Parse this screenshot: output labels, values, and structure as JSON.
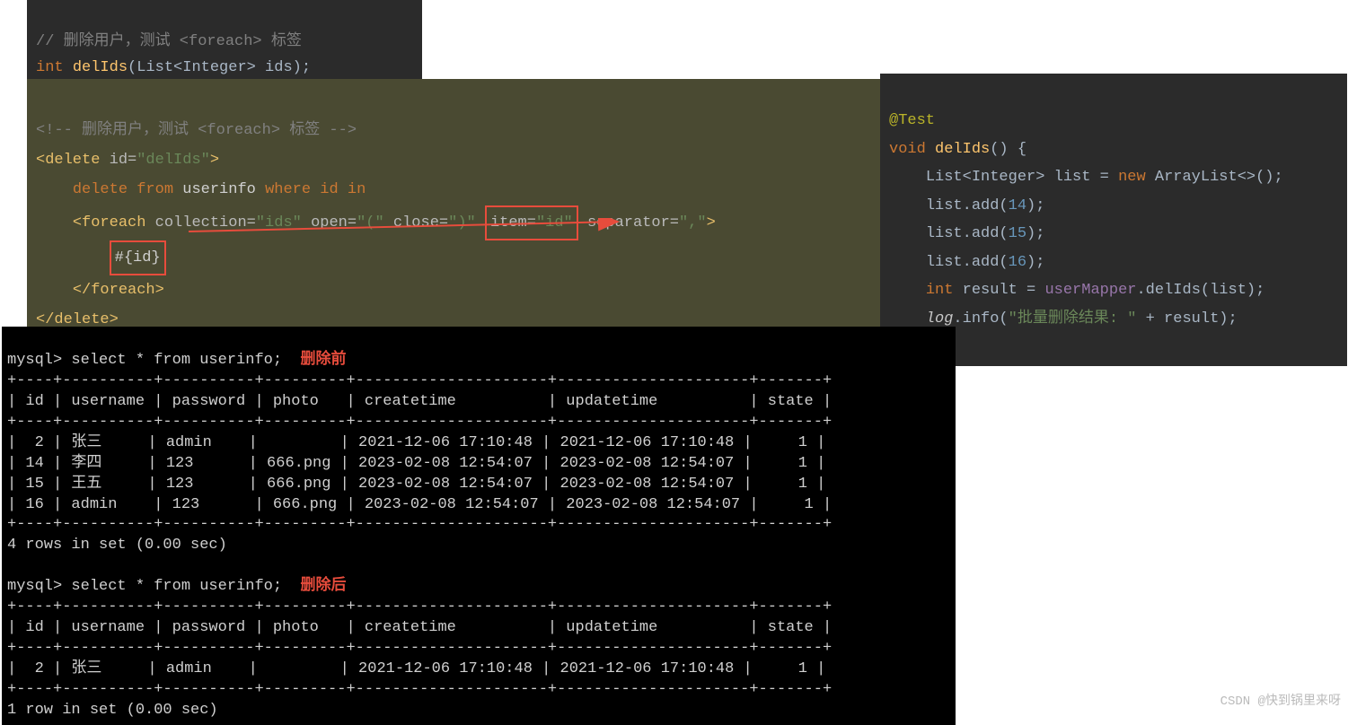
{
  "block1": {
    "comment": "// 删除用户，测试 <foreach> 标签",
    "kw_int": "int",
    "method": "delIds",
    "sig": "(List<Integer> ids);"
  },
  "block2": {
    "xml_comment": "<!-- 删除用户，测试 <foreach> 标签 -->",
    "open_delete": "<delete",
    "attr_id": "id=",
    "val_id": "\"delIds\"",
    "gt": ">",
    "sql_delete": "delete",
    "sql_from": "from",
    "sql_table": "userinfo",
    "sql_where": "where",
    "sql_id": "id",
    "sql_in": "in",
    "open_foreach": "<foreach",
    "attr_collection": "collection=",
    "val_collection": "\"ids\"",
    "attr_open": "open=",
    "val_open": "\"(\"",
    "attr_close": "close=",
    "val_close": "\")\"",
    "attr_item": "item=",
    "val_item": "\"id\"",
    "attr_sep": "separator=",
    "val_sep": "\",\"",
    "placeholder": "#{id}",
    "close_foreach": "</foreach>",
    "close_delete": "</delete>"
  },
  "block3": {
    "ann": "@Test",
    "void": "void",
    "method": "delIds",
    "sig": "() {",
    "list_decl1": "List<Integer> list = ",
    "new": "new",
    "arraylist": " ArrayList<>();",
    "add1_pre": "list.add(",
    "add1_val": "14",
    "add1_post": ");",
    "add2_val": "15",
    "add3_val": "16",
    "int": "int",
    "result_eq": " result = ",
    "mapper": "userMapper",
    "dot_del": ".delIds(list);",
    "log": "log",
    "dot_info": ".info(",
    "info_str": "\"批量删除结果: \"",
    "plus_result": " + result);",
    "close": "}"
  },
  "terminal": {
    "prompt1": "mysql> select * from userinfo;",
    "ann_before": "删除前",
    "divider": "+----+----------+----------+---------+---------------------+---------------------+-------+",
    "header": "| id | username | password | photo   | createtime          | updatetime          | state |",
    "rows_before": [
      "|  2 | 张三     | admin    |         | 2021-12-06 17:10:48 | 2021-12-06 17:10:48 |     1 |",
      "| 14 | 李四     | 123      | 666.png | 2023-02-08 12:54:07 | 2023-02-08 12:54:07 |     1 |",
      "| 15 | 王五     | 123      | 666.png | 2023-02-08 12:54:07 | 2023-02-08 12:54:07 |     1 |",
      "| 16 | admin    | 123      | 666.png | 2023-02-08 12:54:07 | 2023-02-08 12:54:07 |     1 |"
    ],
    "rows_before_summary": "4 rows in set (0.00 sec)",
    "prompt2": "mysql> select * from userinfo;",
    "ann_after": "删除后",
    "rows_after": [
      "|  2 | 张三     | admin    |         | 2021-12-06 17:10:48 | 2021-12-06 17:10:48 |     1 |"
    ],
    "rows_after_summary": "1 row in set (0.00 sec)"
  },
  "watermark": "CSDN @快到锅里来呀"
}
